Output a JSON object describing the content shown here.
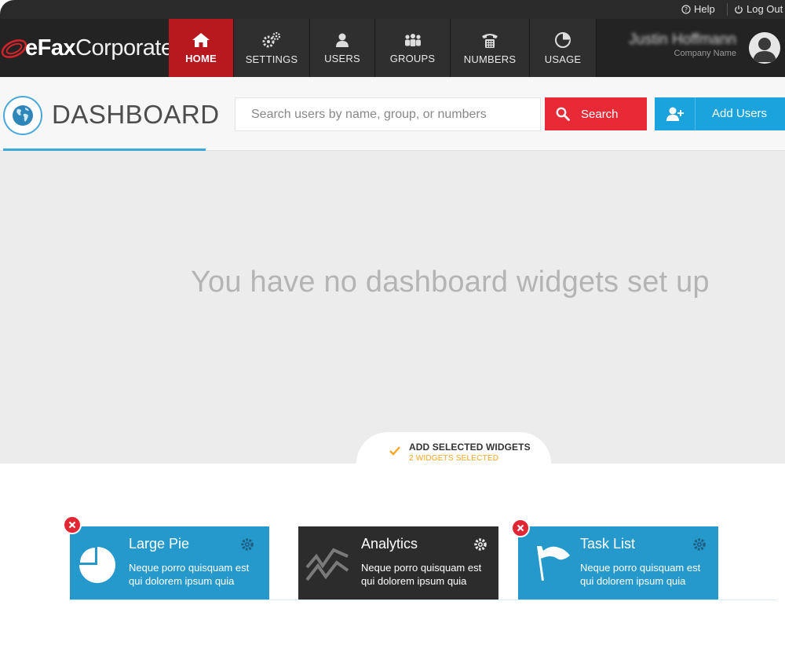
{
  "topbar": {
    "help_label": "Help",
    "logout_label": "Log Out"
  },
  "brand": {
    "part1": "eFax",
    "part2": "Corporate"
  },
  "nav": {
    "items": [
      {
        "label": "HOME",
        "icon": "home-icon"
      },
      {
        "label": "SETTINGS",
        "icon": "gears-icon"
      },
      {
        "label": "USERS",
        "icon": "user-icon"
      },
      {
        "label": "GROUPS",
        "icon": "group-icon"
      },
      {
        "label": "NUMBERS",
        "icon": "phone-icon"
      },
      {
        "label": "USAGE",
        "icon": "pie-chart-icon"
      }
    ]
  },
  "user": {
    "name": "Justin Hoffmann",
    "company": "Company Name",
    "avatar": "avatar-icon"
  },
  "dashboard": {
    "title": "DASHBOARD",
    "icon": "globe-icon",
    "search_placeholder": "Search users by name, group, or numbers",
    "search_label": "Search",
    "add_users_label": "Add Users",
    "empty_message": "You have no dashboard widgets set up"
  },
  "widgets_tab": {
    "title": "ADD SELECTED WIDGETS",
    "subtitle": "2 WIDGETS SELECTED"
  },
  "widgets": [
    {
      "title": "Large Pie",
      "desc_line1": "Neque porro quisquam est",
      "desc_line2": "qui dolorem ipsum quia",
      "selected": true,
      "icon": "pie-icon"
    },
    {
      "title": "Analytics",
      "desc_line1": "Neque porro quisquam est",
      "desc_line2": "qui dolorem ipsum quia",
      "selected": false,
      "icon": "analytics-icon"
    },
    {
      "title": "Task List",
      "desc_line1": "Neque porro quisquam est",
      "desc_line2": "qui dolorem ipsum quia",
      "selected": true,
      "icon": "flag-icon"
    }
  ],
  "colors": {
    "accent_red": "#b7191f",
    "search_red": "#e82a36",
    "accent_blue": "#1aa3dc",
    "widget_blue": "#2599cc",
    "widget_dark": "#2c2c2c"
  }
}
